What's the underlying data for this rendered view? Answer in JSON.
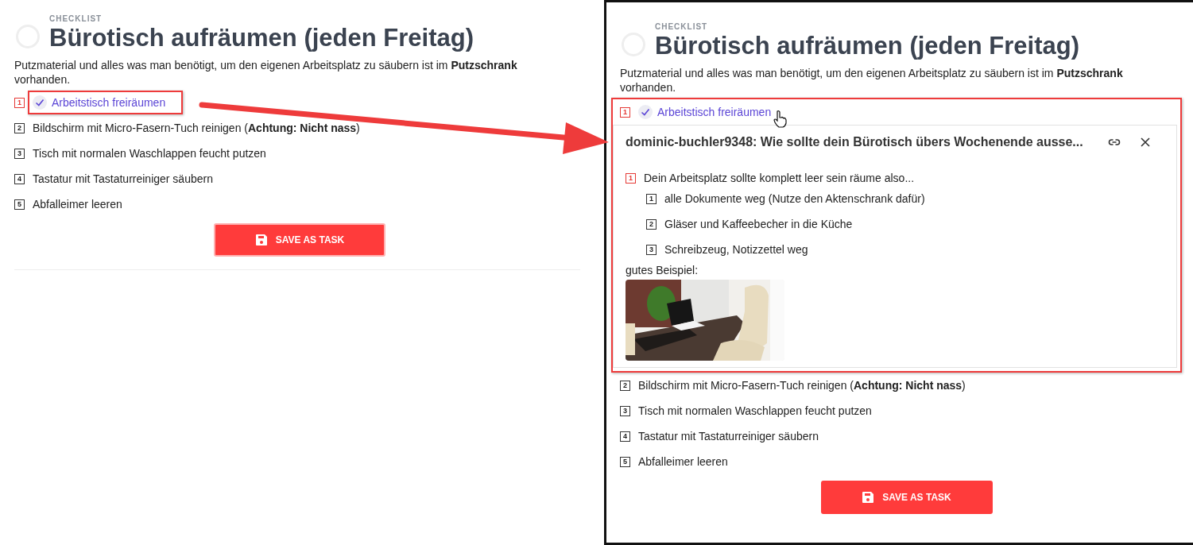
{
  "panels": [
    {
      "kind": "plain",
      "label": "CHECKLIST",
      "title": "Bürotisch aufräumen (jeden Freitag)",
      "description": "Putzmaterial und alles was man benötigt, um den eigenen Arbeitsplatz zu säubern ist im **Putzschrank** vorhanden.",
      "items": [
        {
          "number": "1",
          "text": "Arbeitstisch freiräumen",
          "checked": true,
          "highlighted": true
        },
        {
          "number": "2",
          "text": "Bildschirm mit Micro-Fasern-Tuch reinigen (**Achtung: Nicht nass**)",
          "checked": false,
          "highlighted": false
        },
        {
          "number": "3",
          "text": "Tisch mit normalen Waschlappen feucht putzen",
          "checked": false,
          "highlighted": false
        },
        {
          "number": "4",
          "text": "Tastatur mit Tastaturreiniger säubern",
          "checked": false,
          "highlighted": false
        },
        {
          "number": "5",
          "text": "Abfalleimer leeren",
          "checked": false,
          "highlighted": false
        }
      ],
      "button": "SAVE AS TASK"
    },
    {
      "kind": "framed",
      "label": "CHECKLIST",
      "title": "Bürotisch aufräumen (jeden Freitag)",
      "description": "Putzmaterial und alles was man benötigt, um den eigenen Arbeitsplatz zu säubern ist im **Putzschrank** vorhanden.",
      "items": [
        {
          "number": "1",
          "text": "Arbeitstisch freiräumen",
          "checked": true,
          "highlighted": true,
          "popup": {
            "title": "dominic-buchler9348: Wie sollte dein Bürotisch übers Wochenende ausse...",
            "items": [
              {
                "number": "1",
                "text": "Dein Arbeitsplatz sollte komplett leer sein räume also...",
                "children": [
                  {
                    "number": "1",
                    "text": "alle Dokumente weg (Nutze den Aktenschrank dafür)"
                  },
                  {
                    "number": "2",
                    "text": "Gläser und Kaffeebecher in die Küche"
                  },
                  {
                    "number": "3",
                    "text": "Schreibzeug, Notizzettel weg"
                  }
                ]
              }
            ],
            "caption": "gutes Beispiel:"
          }
        },
        {
          "number": "2",
          "text": "Bildschirm mit Micro-Fasern-Tuch reinigen (**Achtung: Nicht nass**)",
          "checked": false,
          "highlighted": false
        },
        {
          "number": "3",
          "text": "Tisch mit normalen Waschlappen feucht putzen",
          "checked": false,
          "highlighted": false
        },
        {
          "number": "4",
          "text": "Tastatur mit Tastaturreiniger säubern",
          "checked": false,
          "highlighted": false
        },
        {
          "number": "5",
          "text": "Abfalleimer leeren",
          "checked": false,
          "highlighted": false
        }
      ],
      "button": "SAVE AS TASK"
    }
  ],
  "annotation": {
    "arrow": true
  }
}
